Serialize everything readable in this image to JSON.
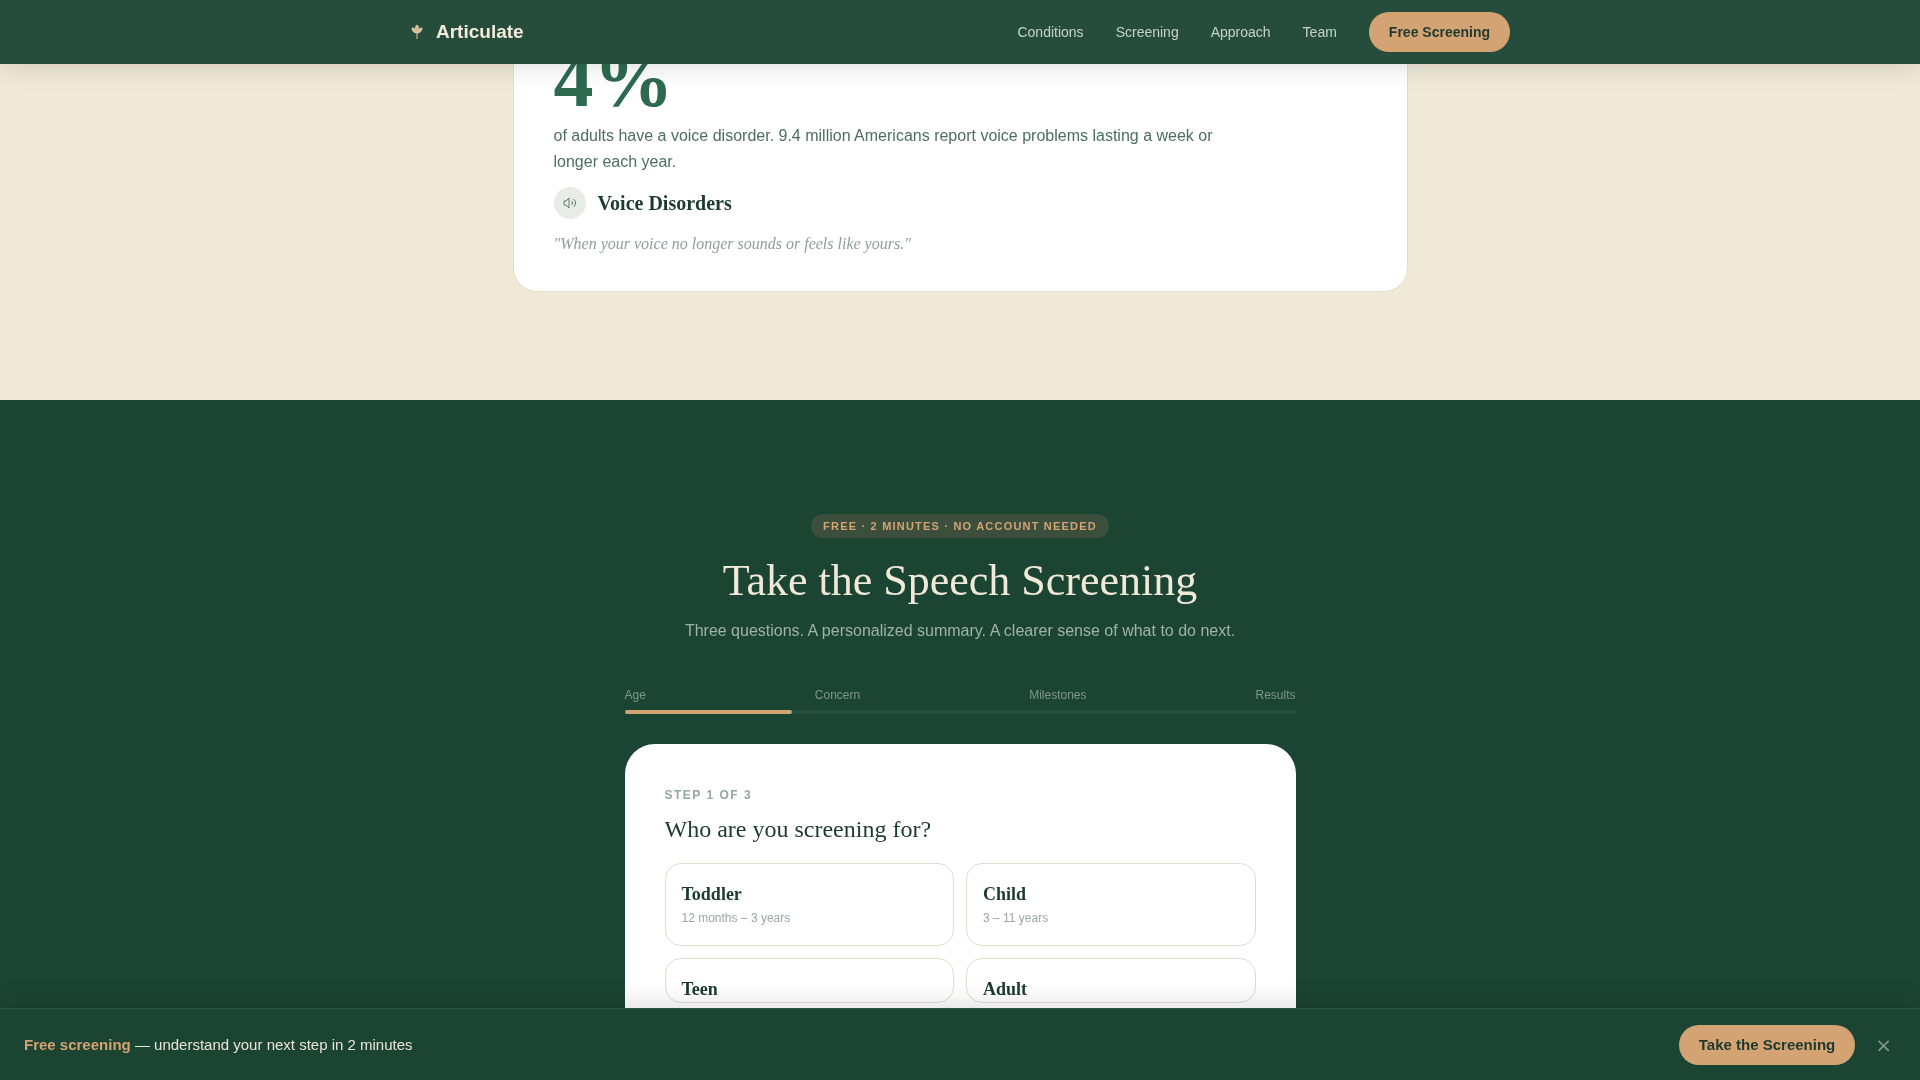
{
  "header": {
    "brand": "Articulate",
    "nav": [
      "Conditions",
      "Screening",
      "Approach",
      "Team"
    ],
    "cta": "Free Screening"
  },
  "stat_card": {
    "stat": "4%",
    "description": "of adults have a voice disorder. 9.4 million Americans report voice problems lasting a week or longer each year.",
    "title": "Voice Disorders",
    "quote": "\"When your voice no longer sounds or feels like yours.\""
  },
  "screening": {
    "badge": "FREE · 2 MINUTES · NO ACCOUNT NEEDED",
    "title": "Take the Speech Screening",
    "subtitle": "Three questions. A personalized summary. A clearer sense of what to do next.",
    "steps": [
      "Age",
      "Concern",
      "Milestones",
      "Results"
    ],
    "progress": {
      "level": 0.25
    },
    "card": {
      "step_label": "STEP 1 OF 3",
      "question": "Who are you screening for?",
      "options": [
        {
          "title": "Toddler",
          "range": "12 months – 3 years"
        },
        {
          "title": "Child",
          "range": "3 – 11 years"
        },
        {
          "title": "Teen"
        },
        {
          "title": "Adult"
        }
      ]
    }
  },
  "bottom_bar": {
    "text": "**Free screening** — understand your next step in 2 minutes",
    "button": "Take the Screening",
    "close": "×"
  }
}
